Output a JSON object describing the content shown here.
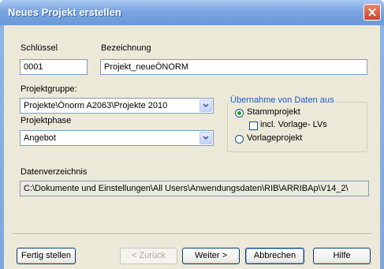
{
  "window": {
    "title": "Neues Projekt erstellen"
  },
  "fields": {
    "schluessel_label": "Schlüssel",
    "schluessel_value": "0001",
    "bezeichnung_label": "Bezeichnung",
    "bezeichnung_value": "Projekt_neueÖNORM",
    "projektgruppe_label": "Projektgruppe:",
    "projektgruppe_value": "Projekte\\Önorm A2063\\Projekte 2010",
    "projektphase_label": "Projektphase",
    "projektphase_value": "Angebot",
    "datenverzeichnis_label": "Datenverzeichnis",
    "datenverzeichnis_value": "C:\\Dokumente und Einstellungen\\All Users\\Anwendungsdaten\\RIB\\ARRIBAp\\V14_2\\"
  },
  "uebernahme": {
    "title": "Übernahme von Daten aus",
    "options": [
      {
        "label": "Stammprojekt",
        "selected": true
      },
      {
        "label": "Vorlageprojekt",
        "selected": false
      }
    ],
    "checkbox_label": "incl. Vorlage- LVs",
    "checkbox_checked": false
  },
  "buttons": {
    "fertig": "Fertig stellen",
    "zurueck": "< Zurück",
    "weiter": "Weiter >",
    "abbrechen": "Abbrechen",
    "hilfe": "Hilfe"
  },
  "icons": {
    "close": "close-icon",
    "dropdown": "chevron-down-icon"
  },
  "colors": {
    "titlebar": "#7aa5e1",
    "close_button": "#c9422a",
    "dialog_background": "#ece9d8",
    "group_title": "#1d5bc7",
    "radio_selected": "#21a121"
  }
}
